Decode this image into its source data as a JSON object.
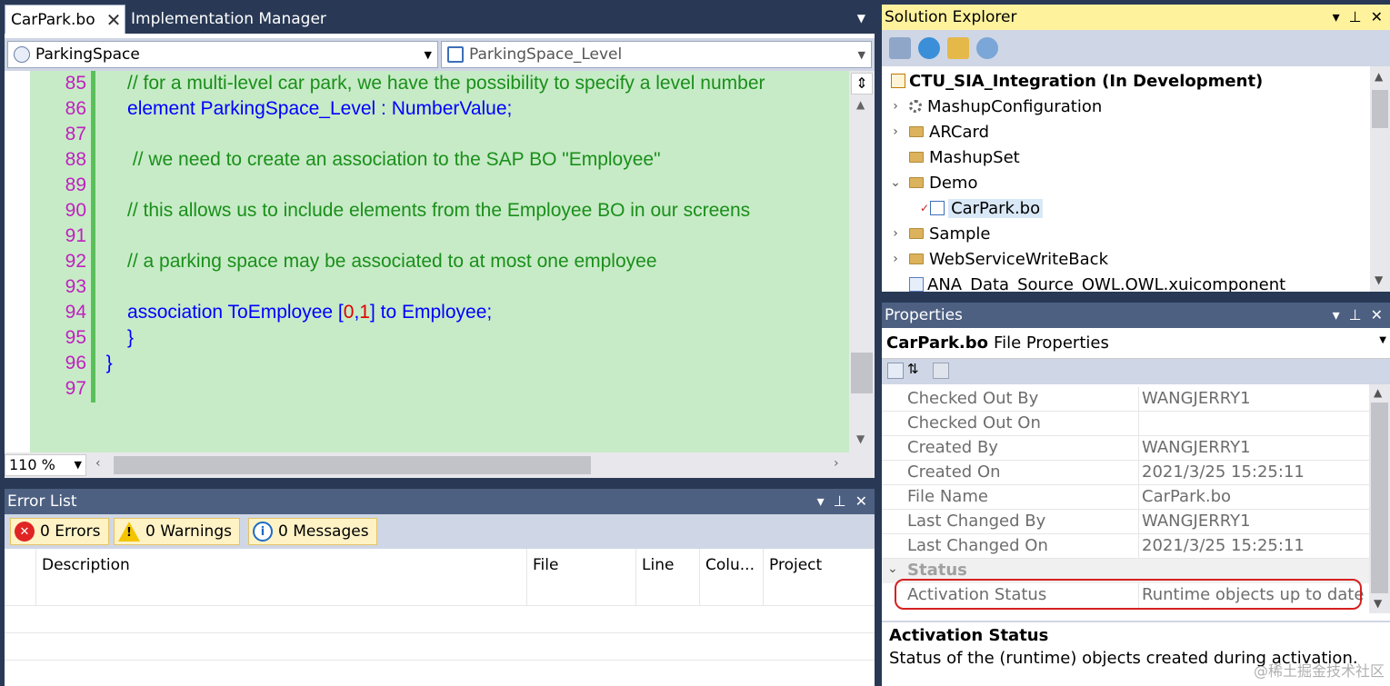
{
  "editor": {
    "tabs": [
      {
        "label": "CarPark.bo",
        "active": true
      },
      {
        "label": "Implementation Manager",
        "active": false
      }
    ],
    "close_glyph": "✕",
    "left_combo": "ParkingSpace",
    "right_combo": "ParkingSpace_Level",
    "zoom": "110 %",
    "lines": [
      {
        "num": "85",
        "indent": "      ",
        "parts": [
          {
            "t": "// for a multi-level car park, we have the possibility to specify a level number",
            "c": "cm"
          }
        ]
      },
      {
        "num": "86",
        "indent": "      ",
        "parts": [
          {
            "t": "element ParkingSpace_Level : NumberValue;",
            "c": "kw"
          }
        ]
      },
      {
        "num": "87",
        "indent": "",
        "parts": []
      },
      {
        "num": "88",
        "indent": "       ",
        "parts": [
          {
            "t": "// we need to create an association to the SAP BO \"Employee\"",
            "c": "cm"
          }
        ]
      },
      {
        "num": "89",
        "indent": "",
        "parts": []
      },
      {
        "num": "90",
        "indent": "      ",
        "parts": [
          {
            "t": "// this allows us to include elements from the Employee BO in our screens",
            "c": "cm"
          }
        ]
      },
      {
        "num": "91",
        "indent": "",
        "parts": []
      },
      {
        "num": "92",
        "indent": "      ",
        "parts": [
          {
            "t": "// a parking space may be associated to at most one employee",
            "c": "cm"
          }
        ]
      },
      {
        "num": "93",
        "indent": "",
        "parts": []
      },
      {
        "num": "94",
        "indent": "      ",
        "parts": [
          {
            "t": "association ToEmployee [",
            "c": "kw"
          },
          {
            "t": "0",
            "c": "num"
          },
          {
            "t": ",",
            "c": "kw"
          },
          {
            "t": "1",
            "c": "num"
          },
          {
            "t": "] to Employee;",
            "c": "kw"
          }
        ]
      },
      {
        "num": "95",
        "indent": "      ",
        "parts": [
          {
            "t": "}",
            "c": "kw"
          }
        ]
      },
      {
        "num": "96",
        "indent": "  ",
        "parts": [
          {
            "t": "}",
            "c": "kw"
          }
        ]
      },
      {
        "num": "97",
        "indent": "",
        "parts": []
      }
    ]
  },
  "error_list": {
    "title": "Error List",
    "filters": {
      "errors": "0 Errors",
      "warnings": "0 Warnings",
      "messages": "0 Messages"
    },
    "columns": [
      "Description",
      "File",
      "Line",
      "Colu...",
      "Project"
    ]
  },
  "solution_explorer": {
    "title": "Solution Explorer",
    "solution": "CTU_SIA_Integration (In Development)",
    "items": [
      {
        "label": "MashupConfiguration",
        "icon": "gear-icon",
        "expander": "›"
      },
      {
        "label": "ARCard",
        "icon": "folder-icon",
        "expander": "›"
      },
      {
        "label": "MashupSet",
        "icon": "folder-icon",
        "expander": ""
      },
      {
        "label": "Demo",
        "icon": "folder-icon",
        "expander": "⌄"
      },
      {
        "label": "CarPark.bo",
        "icon": "bo-file-icon",
        "expander": ""
      },
      {
        "label": "Sample",
        "icon": "folder-icon",
        "expander": "›"
      },
      {
        "label": "WebServiceWriteBack",
        "icon": "folder-icon",
        "expander": "›"
      },
      {
        "label": "ANA_Data_Source_OWL.OWL.xuicomponent",
        "icon": "component-icon",
        "expander": ""
      }
    ]
  },
  "properties": {
    "title": "Properties",
    "object_name": "CarPark.bo",
    "object_type": "File Properties",
    "rows": [
      {
        "key": "Checked Out By",
        "value": "WANGJERRY1"
      },
      {
        "key": "Checked Out On",
        "value": ""
      },
      {
        "key": "Created By",
        "value": "WANGJERRY1"
      },
      {
        "key": "Created On",
        "value": "2021/3/25 15:25:11"
      },
      {
        "key": "File Name",
        "value": "CarPark.bo"
      },
      {
        "key": "Last Changed By",
        "value": "WANGJERRY1"
      },
      {
        "key": "Last Changed On",
        "value": "2021/3/25 15:25:11"
      }
    ],
    "category": "Status",
    "status_row": {
      "key": "Activation Status",
      "value": "Runtime objects up to date"
    },
    "description_title": "Activation Status",
    "description_text": "Status of the (runtime) objects created during activation.",
    "watermark": "@稀土掘金技术社区"
  }
}
